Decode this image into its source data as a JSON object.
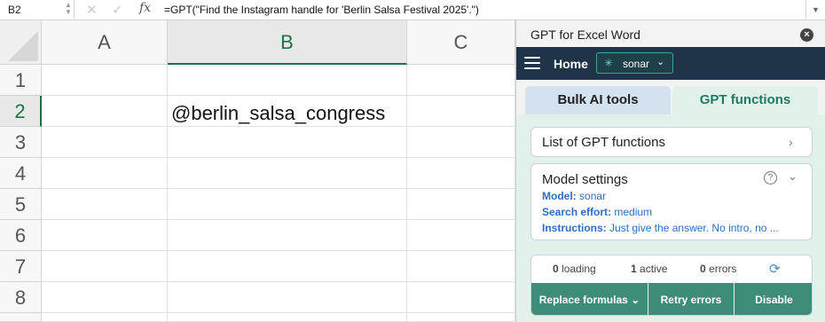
{
  "formula_bar": {
    "cell_ref": "B2",
    "cancel_icon": "x-icon",
    "confirm_icon": "check-icon",
    "fx_label": "fx",
    "formula": "=GPT(\"Find the Instagram handle for 'Berlin Salsa Festival 2025'.\")"
  },
  "sheet": {
    "columns": [
      "A",
      "B",
      "C"
    ],
    "rows": [
      "1",
      "2",
      "3",
      "4",
      "5",
      "6",
      "7",
      "8"
    ],
    "selected_column": "B",
    "selected_row": "2",
    "cell_b2": "@berlin_salsa_congress"
  },
  "panel": {
    "title": "GPT for Excel Word",
    "nav": {
      "home_label": "Home",
      "model": "sonar"
    },
    "tabs": {
      "bulk": "Bulk AI tools",
      "functions": "GPT functions",
      "active": "functions"
    },
    "list_functions_label": "List of GPT functions",
    "model_settings": {
      "title": "Model settings",
      "model_label": "Model:",
      "model_value": "sonar",
      "effort_label": "Search effort:",
      "effort_value": "medium",
      "instructions_label": "Instructions:",
      "instructions_value": "Just give the answer. No intro, no ..."
    },
    "status": {
      "loading_count": "0",
      "loading_label": "loading",
      "active_count": "1",
      "active_label": "active",
      "errors_count": "0",
      "errors_label": "errors"
    },
    "buttons": {
      "replace": "Replace formulas",
      "retry": "Retry errors",
      "disable": "Disable"
    }
  },
  "colors": {
    "excel_green": "#1f7245",
    "nav_bg": "#1f3448",
    "accent_teal": "#3d8d79",
    "link_blue": "#2b6dc9"
  }
}
